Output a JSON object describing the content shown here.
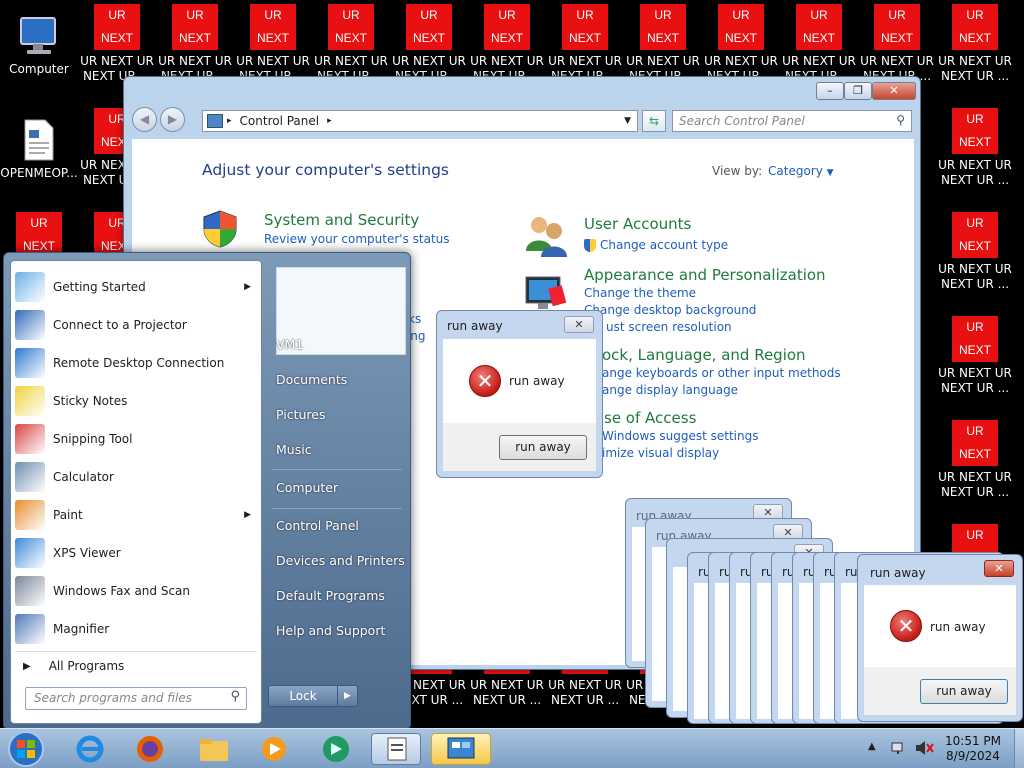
{
  "desktop": {
    "computer_label": "Computer",
    "doc_label": "OPENMEOP...",
    "ur_top": "UR",
    "ur_bottom": "NEXT",
    "ur_label": "UR NEXT UR NEXT UR ...",
    "partial_label_r": "R"
  },
  "control_panel": {
    "breadcrumb": "Control Panel",
    "search_placeholder": "Search Control Panel",
    "heading": "Adjust your computer's settings",
    "view_by_label": "View by:",
    "view_by_value": "Category",
    "categories": [
      {
        "title": "System and Security",
        "links": [
          "Review your computer's status",
          "ks",
          "ring"
        ]
      },
      {
        "title": "User Accounts",
        "links": [
          "Change account type"
        ]
      },
      {
        "title": "Appearance and Personalization",
        "links": [
          "Change the theme",
          "Change desktop background",
          "ust screen resolution"
        ]
      },
      {
        "title": "ock, Language, and Region",
        "links": [
          "ange keyboards or other input methods",
          "ange display language"
        ]
      },
      {
        "title": "se of Access",
        "links": "Windows suggest settings|imize visual display"
      }
    ]
  },
  "dialog": {
    "title": "run away",
    "message": "run away",
    "button": "run away",
    "stack_title_partial": "run away",
    "stack_letters": "ru"
  },
  "start_menu": {
    "left_items": [
      {
        "label": "Getting Started",
        "submenu": true
      },
      {
        "label": "Connect to a Projector",
        "submenu": false
      },
      {
        "label": "Remote Desktop Connection",
        "submenu": false
      },
      {
        "label": "Sticky Notes",
        "submenu": false
      },
      {
        "label": "Snipping Tool",
        "submenu": false
      },
      {
        "label": "Calculator",
        "submenu": false
      },
      {
        "label": "Paint",
        "submenu": true
      },
      {
        "label": "XPS Viewer",
        "submenu": false
      },
      {
        "label": "Windows Fax and Scan",
        "submenu": false
      },
      {
        "label": "Magnifier",
        "submenu": false
      }
    ],
    "all_programs": "All Programs",
    "search_placeholder": "Search programs and files",
    "right_items": [
      "VM1",
      "Documents",
      "Pictures",
      "Music",
      "Computer",
      "Control Panel",
      "Devices and Printers",
      "Default Programs",
      "Help and Support"
    ],
    "lock_label": "Lock"
  },
  "taskbar": {
    "time": "10:51 PM",
    "date": "8/9/2024"
  },
  "colors": {
    "accent_link": "#1e5ebd",
    "category_green": "#1e7b3b",
    "ur_red": "#e81010"
  }
}
